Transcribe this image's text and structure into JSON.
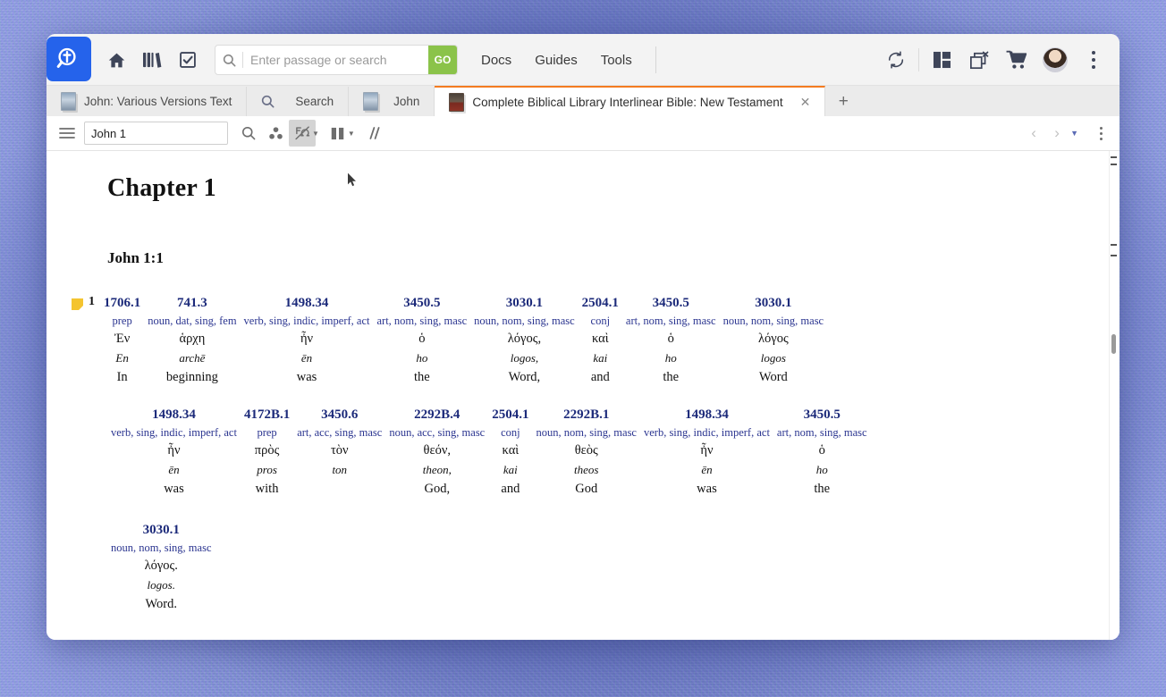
{
  "window": {
    "topbar": {
      "logo_icon": "magnifier-cross-logo",
      "icons": [
        {
          "name": "home-icon",
          "label": "Home"
        },
        {
          "name": "library-icon",
          "label": "Library"
        },
        {
          "name": "checkbox-book-icon",
          "label": "Reading Plans"
        }
      ],
      "search": {
        "placeholder": "Enter passage or search",
        "value": "",
        "go_label": "GO"
      },
      "nav_links": [
        "Docs",
        "Guides",
        "Tools"
      ],
      "right_icons": [
        {
          "name": "sync-icon"
        },
        {
          "name": "layout-panels-icon"
        },
        {
          "name": "close-all-windows-icon"
        },
        {
          "name": "cart-icon"
        },
        {
          "name": "avatar"
        },
        {
          "name": "overflow-menu-icon"
        }
      ]
    },
    "tabs": [
      {
        "label": "John: Various Versions Text",
        "icon": "book-thumbnail-icon",
        "active": false,
        "closable": false
      },
      {
        "label": "Search",
        "icon": "search-icon",
        "active": false,
        "closable": false
      },
      {
        "label": "John",
        "icon": "book-thumbnail-icon",
        "active": false,
        "closable": false
      },
      {
        "label": "Complete Biblical Library Interlinear Bible: New Testament",
        "icon": "book-thumbnail-dark-icon",
        "active": true,
        "closable": true
      }
    ],
    "new_tab_label": "+",
    "doc_toolbar": {
      "menu_icon": "hamburger-menu-icon",
      "reference_value": "John 1",
      "icons": [
        {
          "name": "search-icon"
        },
        {
          "name": "visual-filters-icon"
        },
        {
          "name": "original-language-icon",
          "active": true
        },
        {
          "name": "columns-layout-icon"
        },
        {
          "name": "parallel-slash-icon"
        }
      ],
      "prev_label": "‹",
      "next_label": "›",
      "overflow_icon": "overflow-menu-icon"
    }
  },
  "document": {
    "chapter_title": "Chapter 1",
    "verse_reference": "John 1:1",
    "verse_number": "1",
    "note_marker": "yellow-note-icon",
    "rows": [
      [
        {
          "strong": "1706.1",
          "parse": "prep",
          "greek": "Ἐν",
          "translit": "En",
          "gloss": "In"
        },
        {
          "strong": "741.3",
          "parse": "noun, dat, sing, fem",
          "greek": "ἁρχη",
          "translit": "archē",
          "gloss": "beginning"
        },
        {
          "strong": "1498.34",
          "parse": "verb, sing, indic, imperf, act",
          "greek": "ἦν",
          "translit": "ēn",
          "gloss": "was"
        },
        {
          "strong": "3450.5",
          "parse": "art, nom, sing, masc",
          "greek": "ὁ",
          "translit": "ho",
          "gloss": "the"
        },
        {
          "strong": "3030.1",
          "parse": "noun, nom, sing, masc",
          "greek": "λόγος,",
          "translit": "logos,",
          "gloss": "Word,"
        },
        {
          "strong": "2504.1",
          "parse": "conj",
          "greek": "καὶ",
          "translit": "kai",
          "gloss": "and"
        },
        {
          "strong": "3450.5",
          "parse": "art, nom, sing, masc",
          "greek": "ὁ",
          "translit": "ho",
          "gloss": "the"
        },
        {
          "strong": "3030.1",
          "parse": "noun, nom, sing, masc",
          "greek": "λόγος",
          "translit": "logos",
          "gloss": "Word"
        }
      ],
      [
        {
          "strong": "1498.34",
          "parse": "verb, sing, indic, imperf, act",
          "greek": "ἦν",
          "translit": "ēn",
          "gloss": "was"
        },
        {
          "strong": "4172B.1",
          "parse": "prep",
          "greek": "πρὸς",
          "translit": "pros",
          "gloss": "with"
        },
        {
          "strong": "3450.6",
          "parse": "art, acc, sing, masc",
          "greek": "τὸν",
          "translit": "ton",
          "gloss": ""
        },
        {
          "strong": "2292B.4",
          "parse": "noun, acc, sing, masc",
          "greek": "θεόν,",
          "translit": "theon,",
          "gloss": "God,"
        },
        {
          "strong": "2504.1",
          "parse": "conj",
          "greek": "καὶ",
          "translit": "kai",
          "gloss": "and"
        },
        {
          "strong": "2292B.1",
          "parse": "noun, nom, sing, masc",
          "greek": "θεὸς",
          "translit": "theos",
          "gloss": "God"
        },
        {
          "strong": "1498.34",
          "parse": "verb, sing, indic, imperf, act",
          "greek": "ἦν",
          "translit": "ēn",
          "gloss": "was"
        },
        {
          "strong": "3450.5",
          "parse": "art, nom, sing, masc",
          "greek": "ὁ",
          "translit": "ho",
          "gloss": "the"
        }
      ],
      [
        {
          "strong": "3030.1",
          "parse": "noun, nom, sing, masc",
          "greek": "λόγος.",
          "translit": "logos.",
          "gloss": "Word."
        }
      ]
    ]
  },
  "colors": {
    "accent_blue": "#2563eb",
    "go_green": "#8bc34a",
    "active_tab_underline": "#f47b20",
    "strong_number": "#1c2a7a",
    "parse_text": "#2b3590",
    "note_yellow": "#f4c430"
  }
}
